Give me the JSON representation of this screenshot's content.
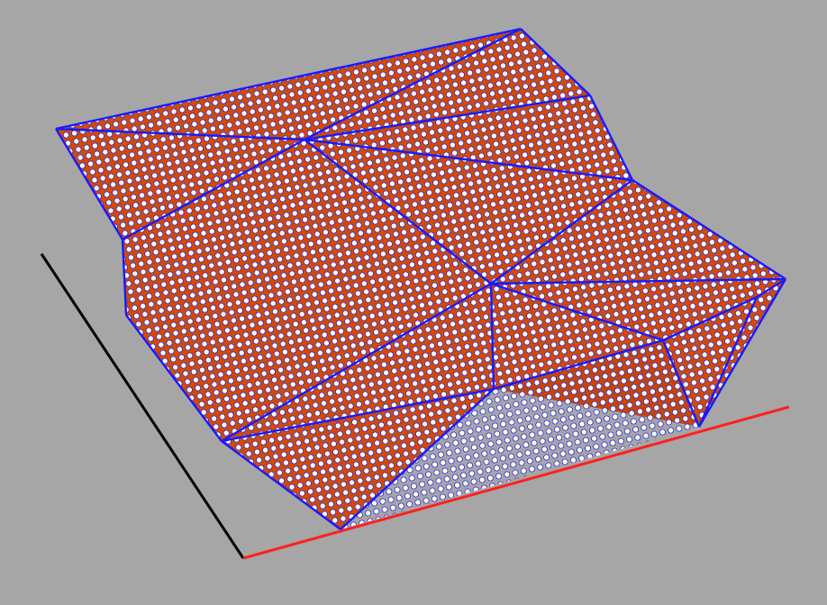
{
  "viewport": {
    "background_color": "#a6a6a6",
    "axes": {
      "x_axis_color": "#ff2020",
      "y_axis_color": "#000000"
    },
    "surface": {
      "fill_color": "#d44a00",
      "edge_color": "#1a1aff",
      "point_fill_color": "#ffffff",
      "point_stroke_color": "#2a2ad8"
    }
  }
}
